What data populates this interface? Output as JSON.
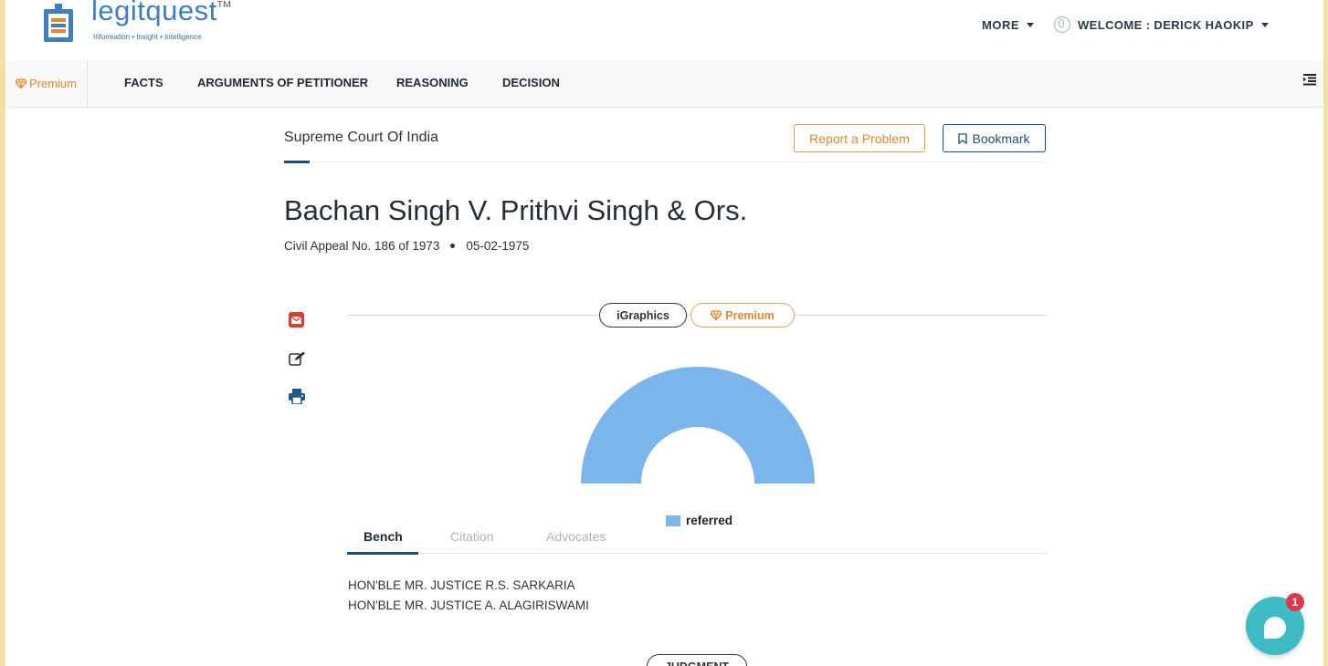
{
  "header": {
    "logo_text": "legitquest",
    "logo_tm": "TM",
    "logo_tagline": "Information • Insight • Intelligence",
    "more_label": "MORE",
    "welcome_label": "WELCOME : DERICK HAOKIP"
  },
  "nav": {
    "premium_label": "Premium",
    "items": [
      "FACTS",
      "ARGUMENTS OF PETITIONER",
      "REASONING",
      "DECISION"
    ]
  },
  "case": {
    "court": "Supreme Court Of India",
    "report_label": "Report a Problem",
    "bookmark_label": "Bookmark",
    "title": "Bachan Singh V. Prithvi Singh & Ors.",
    "appeal": "Civil Appeal No. 186 of 1973",
    "date": "05-02-1975"
  },
  "igraphics": {
    "label": "iGraphics",
    "premium_label": "Premium"
  },
  "chart_data": {
    "type": "pie",
    "categories": [
      "referred"
    ],
    "values": [
      100
    ],
    "colors": [
      "#7cb5ec"
    ],
    "legend": [
      "referred"
    ],
    "legend_position": "bottom"
  },
  "tabs": [
    "Bench",
    "Citation",
    "Advocates"
  ],
  "bench": [
    "HON'BLE MR. JUSTICE R.S. SARKARIA",
    "HON'BLE MR. JUSTICE A. ALAGIRISWAMI"
  ],
  "judgment_label": "JUDGMENT",
  "chat": {
    "badge": "1"
  },
  "colors": {
    "brand_blue": "#1d4f79",
    "premium_orange": "#e2882f",
    "chart_blue": "#7cb5ec",
    "chat_teal": "#3dbcc6"
  }
}
